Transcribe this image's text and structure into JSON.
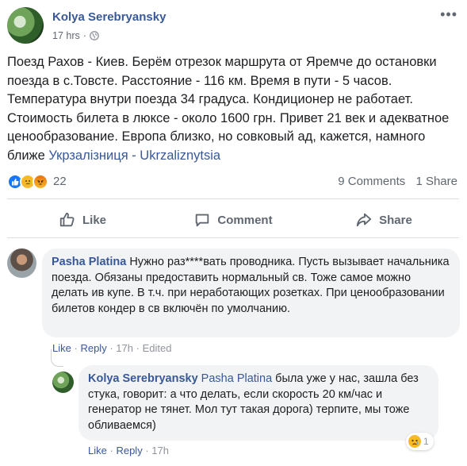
{
  "post": {
    "author": "Kolya Serebryansky",
    "time": "17 hrs",
    "dot": "·",
    "text": "Поезд Рахов - Киев. Берём отрезок маршрута от Яремче до остановки поезда в с.Товсте. Расстояние - 116 км. Время в пути - 5 часов. Температура внутри поезда 34 градуса. Кондиционер не работает. Стоимость билета в люксе - около 1600 грн. Привет 21 век и адекватное ценообразование. Европа близко, но совковый ад, кажется, намного ближе",
    "tagged_page": "Укрзалізниця - Ukrzaliznytsia",
    "reactions_count": "22",
    "comments_count": "9 Comments",
    "shares_count": "1 Share",
    "colors": {
      "link": "#385898",
      "like_blue": "#1877f2",
      "sad_yellow": "#f7b928"
    }
  },
  "actions": {
    "like": "Like",
    "comment": "Comment",
    "share": "Share"
  },
  "comments": [
    {
      "author": "Pasha Platina",
      "text": "Нужно раз****вать проводника. Пусть вызывает начальника поезда. Обязаны предоставить нормальный св. Тоже самое можно делать ив купе. В т.ч. при неработающих розетках. При ценообразовании билетов кондер в св включён по умолчанию.",
      "like": "Like",
      "reply": "Reply",
      "time": "17h",
      "edited": "Edited",
      "sep": "·"
    },
    {
      "author": "Kolya Serebryansky",
      "mention": "Pasha Platina",
      "text": " была уже у нас, зашла без стука, говорит: а что делать, если скорость 20 км/час и генератор не тянет. Мол тут такая дорога) терпите, мы тоже обливаемся)",
      "like": "Like",
      "reply": "Reply",
      "time": "17h",
      "sep": "·",
      "reaction_count": "1"
    }
  ]
}
